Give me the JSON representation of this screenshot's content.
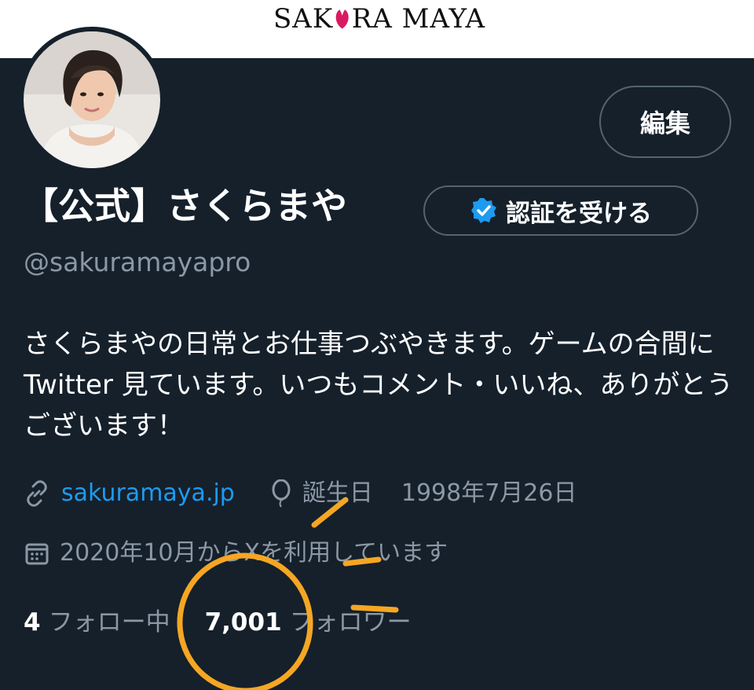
{
  "banner": {
    "logo_left": "SAK",
    "logo_right": "RA MAYA"
  },
  "profile": {
    "edit_label": "編集",
    "display_name": "【公式】さくらまや",
    "verify_label": "認証を受ける",
    "handle": "@sakuramayapro",
    "bio": "さくらまやの日常とお仕事つぶやきます。ゲームの合間に Twitter 見ています。いつもコメント・いいね、ありがとうございます！",
    "website": "sakuramaya.jp",
    "birthday_label": "誕生日",
    "birthday_value": "1998年7月26日",
    "joined": "2020年10月からXを利用しています",
    "following_count": "4",
    "following_label": "フォロー中",
    "followers_count": "7,001",
    "followers_label": "フォロワー"
  },
  "colors": {
    "background": "#15202b",
    "accent": "#1d9bf0",
    "muted": "#8b98a5",
    "annotation": "#f5a623"
  },
  "icons": [
    "link-icon",
    "balloon-icon",
    "calendar-icon",
    "verified-badge-icon"
  ]
}
